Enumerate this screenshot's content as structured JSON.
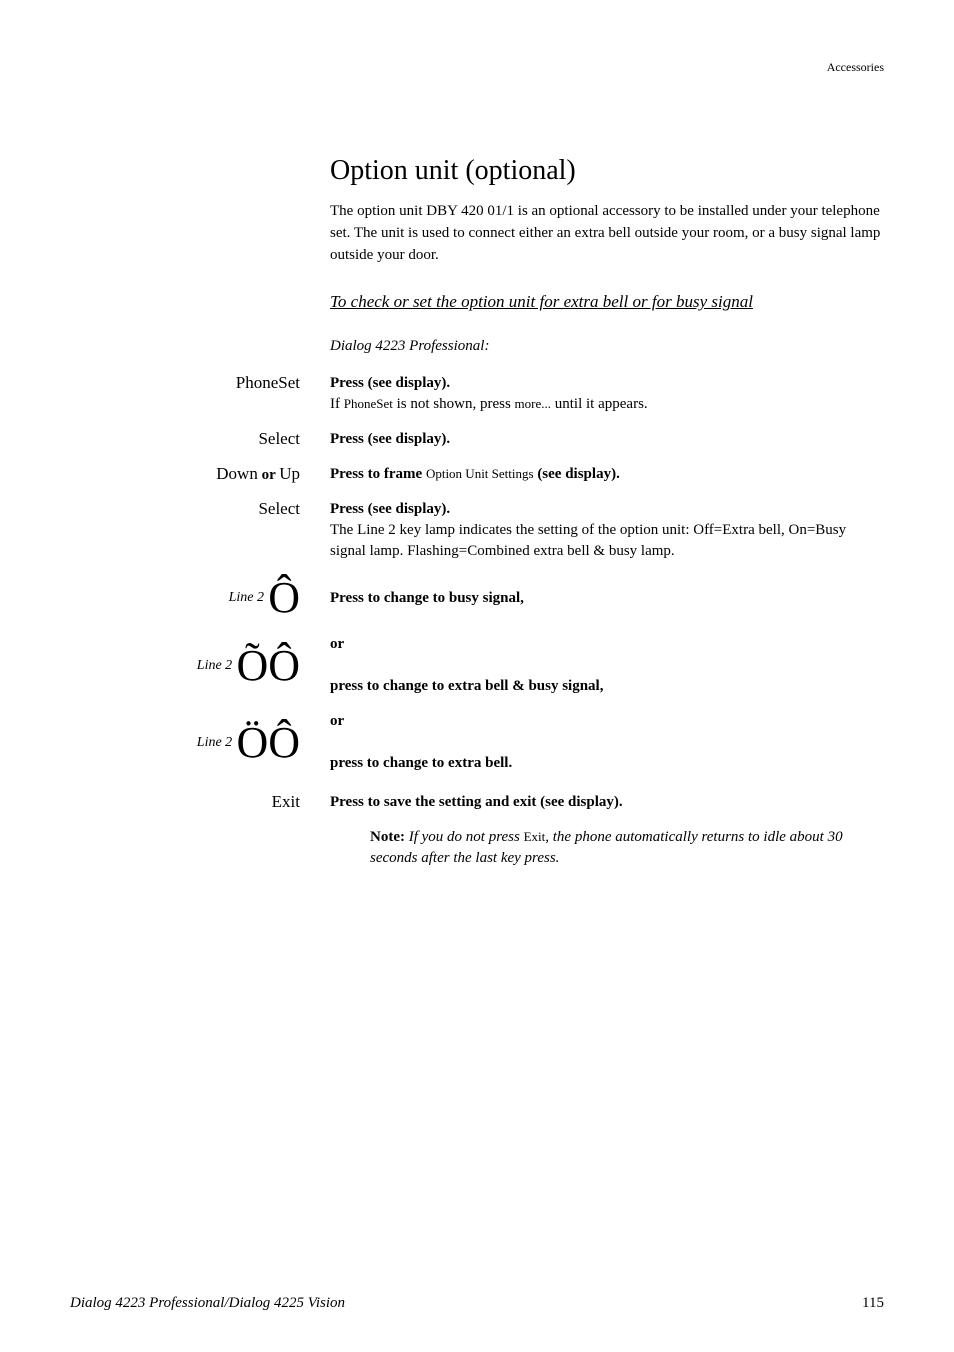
{
  "header": {
    "category": "Accessories"
  },
  "title": "Option unit (optional)",
  "intro": "The option unit DBY 420 01/1 is an optional accessory to be installed under your telephone set. The unit is used to connect either an extra bell outside your room, or a busy signal lamp outside your door.",
  "subsection": "To check or set the option unit for extra bell or for busy signal",
  "model_label": "Dialog 4223 Professional:",
  "rows": {
    "r1_left": "PhoneSet",
    "r1_right_bold": "Press (see display).",
    "r1_right_text_a": "If ",
    "r1_right_text_phoneset": "PhoneSet",
    "r1_right_text_b": " is not shown, press ",
    "r1_right_text_more": "more...",
    "r1_right_text_c": " until it appears.",
    "r2_left": "Select",
    "r2_right_bold": "Press (see display).",
    "r3_left_a": "Down",
    "r3_left_or": " or ",
    "r3_left_b": "Up",
    "r3_right_bold_a": "Press to frame ",
    "r3_right_small": "Option Unit Settings",
    "r3_right_bold_b": " (see display).",
    "r4_left": "Select",
    "r4_right_bold": "Press (see display).",
    "r4_right_text": "The Line 2 key lamp indicates the setting of the option unit: Off=Extra bell, On=Busy signal lamp. Flashing=Combined extra bell & busy lamp.",
    "r5_left_line": "Line 2",
    "r5_icon": "Ô",
    "r5_right_bold": "Press to change to busy signal,",
    "r6_or": "or",
    "r6_left_line": "Line 2",
    "r6_icon_a": "Õ",
    "r6_icon_b": "Ô",
    "r6_right_bold": "press to change to extra bell & busy signal,",
    "r7_or": "or",
    "r7_left_line": "Line 2",
    "r7_icon_a": "Ö",
    "r7_icon_b": "Ô",
    "r7_right_bold": "press to change to extra bell.",
    "r8_left": "Exit",
    "r8_right_bold": "Press to save the setting and exit (see display)."
  },
  "note": {
    "label": "Note: ",
    "text_a": "If you do not press ",
    "exit_small": "Exit",
    "text_b": ", the phone automatically returns to idle about 30 seconds after the last key press."
  },
  "footer": {
    "left": "Dialog 4223 Professional/Dialog 4225 Vision",
    "right": "115"
  }
}
